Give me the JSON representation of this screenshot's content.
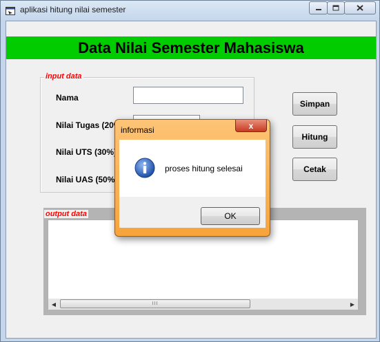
{
  "window": {
    "title": "aplikasi hitung nilai semester",
    "icons": {
      "app": "app-window-icon",
      "minimize": "minimize-icon",
      "maximize": "maximize-icon",
      "close": "close-icon"
    }
  },
  "banner": {
    "text": "Data Nilai Semester Mahasiswa",
    "color": "#00cc00"
  },
  "input_group": {
    "legend": "input data",
    "fields": {
      "nama": {
        "label": "Nama",
        "value": ""
      },
      "tugas": {
        "label": "Nilai Tugas (20%)",
        "value": ""
      },
      "uts": {
        "label": "Nilai UTS (30%)",
        "value": ""
      },
      "uas": {
        "label": "Nilai UAS (50%)",
        "value": ""
      }
    }
  },
  "buttons": {
    "simpan": "Simpan",
    "hitung": "Hitung",
    "cetak": "Cetak"
  },
  "output_group": {
    "legend": "output data",
    "text": "",
    "scroll_left": "◀",
    "scroll_right": "▶",
    "thumb_grip": "III"
  },
  "dialog": {
    "title": "informasi",
    "close_glyph": "x",
    "icon": "info-icon",
    "message": "proses hitung selesai",
    "ok_label": "OK"
  },
  "colors": {
    "legend": "#ff0000",
    "dialog_frame": "#f7a33b",
    "close_button": "#c63b22"
  }
}
